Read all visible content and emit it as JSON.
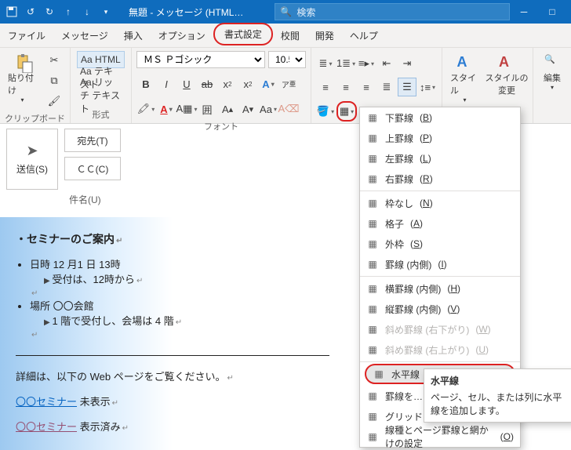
{
  "title": "無題 - メッセージ (HTML…",
  "search_placeholder": "検索",
  "tabs": [
    "ファイル",
    "メッセージ",
    "挿入",
    "オプション",
    "書式設定",
    "校閲",
    "開発",
    "ヘルプ"
  ],
  "active_tab_index": 4,
  "ribbon": {
    "clipboard": {
      "label": "クリップボード",
      "paste": "貼り付け"
    },
    "format_group": {
      "label": "形式",
      "html": "Aa HTML",
      "text": "Aa テキスト",
      "rich": "Aa リッチ テキスト"
    },
    "font_group": {
      "label": "フォント",
      "font": "ＭＳ Ｐゴシック",
      "size": "10.5"
    },
    "styles": {
      "style": "スタイル",
      "change": "スタイルの\n変更"
    },
    "edit": {
      "label": "編集"
    }
  },
  "border_btn_open": true,
  "compose": {
    "send": "送信(S)",
    "to": "宛先(T)",
    "cc": "ＣＣ(C)",
    "subject": "件名(U)"
  },
  "body": {
    "heading": "・セミナーのご案内",
    "line1": "日時 12 月1 日 13時",
    "line1a": "受付は、12時から",
    "line2": "場所 〇〇会館",
    "line2a": "1 階で受付し、会場は 4 階",
    "p1": "詳細は、以下の Web ページをご覧ください。",
    "link1": "〇〇セミナー",
    "link1s": "未表示",
    "link2": "〇〇セミナー",
    "link2s": "表示済み"
  },
  "menu": {
    "items": [
      {
        "t": "下罫線(B)",
        "k": "B",
        "disabled": false
      },
      {
        "t": "上罫線(P)",
        "k": "P",
        "disabled": false
      },
      {
        "t": "左罫線(L)",
        "k": "L",
        "disabled": false
      },
      {
        "t": "右罫線(R)",
        "k": "R",
        "disabled": false
      },
      {
        "sep": true
      },
      {
        "t": "枠なし(N)",
        "k": "N",
        "disabled": false
      },
      {
        "t": "格子(A)",
        "k": "A",
        "disabled": false
      },
      {
        "t": "外枠(S)",
        "k": "S",
        "disabled": false
      },
      {
        "t": "罫線 (内側)(I)",
        "k": "I",
        "disabled": false
      },
      {
        "sep": true
      },
      {
        "t": "横罫線 (内側)(H)",
        "k": "H",
        "disabled": false
      },
      {
        "t": "縦罫線 (内側)(V)",
        "k": "V",
        "disabled": false
      },
      {
        "t": "斜め罫線 (右下がり)(W)",
        "k": "W",
        "disabled": true
      },
      {
        "t": "斜め罫線 (右上がり)(U)",
        "k": "U",
        "disabled": true
      },
      {
        "sep": true
      },
      {
        "t": "水平線(Z)",
        "k": "Z",
        "sel": true
      },
      {
        "t": "罫線を…",
        "k": "",
        "disabled": false
      },
      {
        "t": "グリッド…",
        "k": "",
        "disabled": false
      },
      {
        "t": "線種とページ罫線と網かけの設定(O)…",
        "k": "O",
        "disabled": false
      }
    ]
  },
  "tooltip": {
    "title": "水平線",
    "body": "ページ、セル、または列に水平線を追加します。"
  }
}
